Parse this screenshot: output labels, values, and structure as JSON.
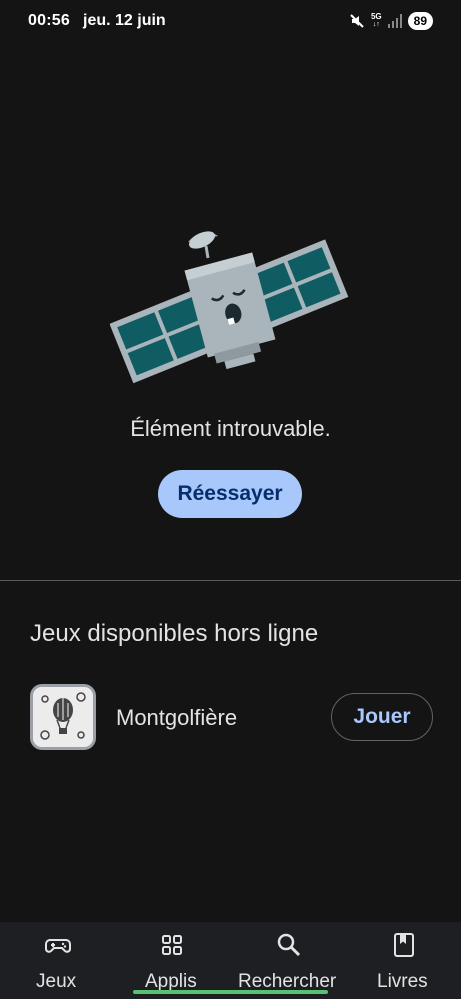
{
  "status": {
    "time": "00:56",
    "date": "jeu. 12 juin",
    "network": "5G",
    "battery": "89",
    "icons": [
      "mute-icon",
      "5g-icon",
      "signal-icon",
      "battery-icon"
    ]
  },
  "main": {
    "error_message": "Élément introuvable.",
    "retry_label": "Réessayer",
    "illustration": "sleeping-satellite"
  },
  "offline_games": {
    "title": "Jeux disponibles hors ligne",
    "games": [
      {
        "name": "Montgolfière",
        "action_label": "Jouer",
        "icon": "hot-air-balloon-icon"
      }
    ]
  },
  "bottom_nav": {
    "items": [
      {
        "label": "Jeux",
        "icon": "gamepad-icon"
      },
      {
        "label": "Applis",
        "icon": "apps-grid-icon",
        "active": true
      },
      {
        "label": "Rechercher",
        "icon": "search-icon"
      },
      {
        "label": "Livres",
        "icon": "bookmark-book-icon"
      }
    ]
  },
  "colors": {
    "background": "#141414",
    "accent": "#a8c7fa",
    "accent_text": "#062e6f",
    "nav_background": "#1e1f22",
    "home_indicator": "#56c271"
  }
}
